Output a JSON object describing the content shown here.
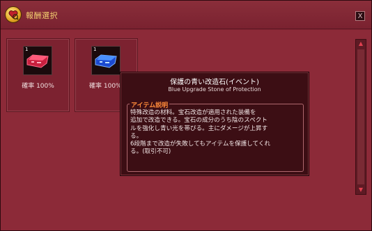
{
  "window": {
    "title": "報酬選択",
    "close_label": "X"
  },
  "items": [
    {
      "count": "1",
      "rate": "確率 100%",
      "color": "#d02040",
      "icon": "red-gem-icon"
    },
    {
      "count": "1",
      "rate": "確率 100%",
      "color": "#2060e0",
      "icon": "blue-gem-icon"
    }
  ],
  "tooltip": {
    "name": "保護の青い改造石(イベント)",
    "sub": "Blue Upgrade Stone of Protection",
    "section_label": "アイテム説明",
    "description": "特殊改造の材料。宝石改造が適用された装備を\n追加で改造できる。宝石の成分のうち陰のスペクト\nルを強化し青い光を帯びる。主にダメージが上昇す\nる。\n6段階まで改造が失敗してもアイテムを保護してくれ\nる。(取引不可)"
  },
  "scrollbar": {
    "up": "▲",
    "down": "▼"
  }
}
